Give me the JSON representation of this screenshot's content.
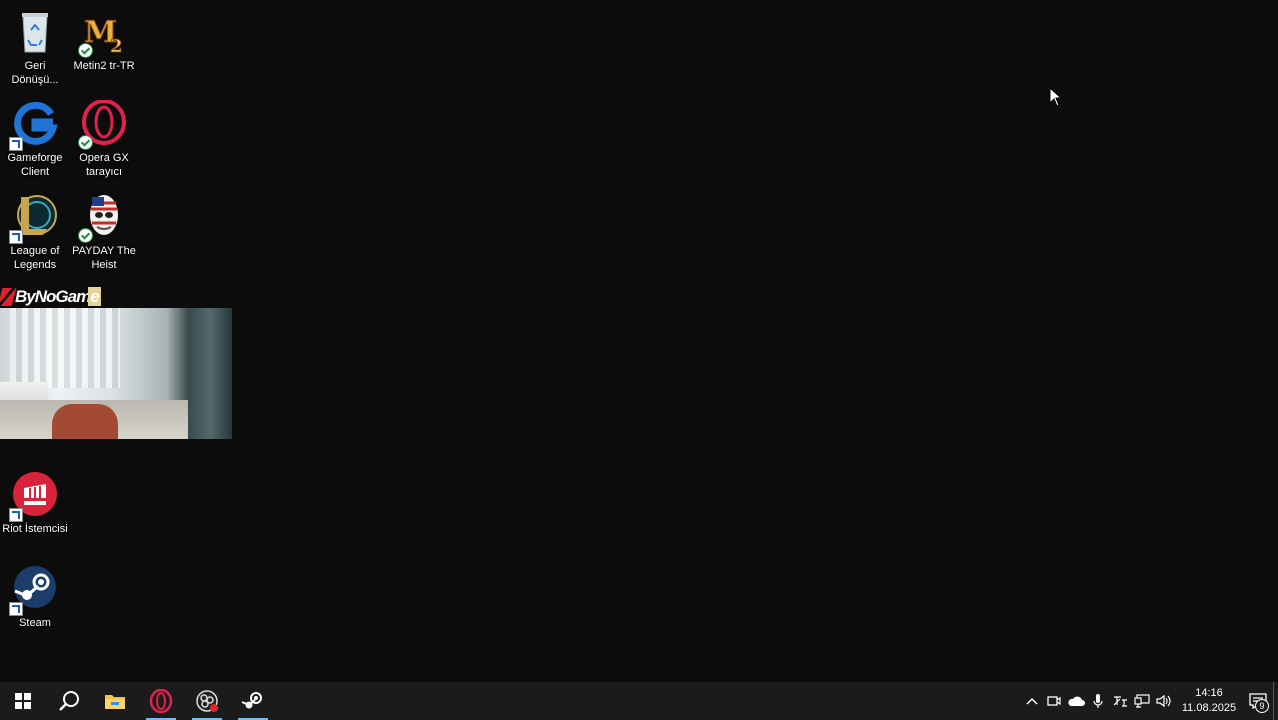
{
  "desktop": {
    "icons": [
      {
        "label": "Geri Dönüşü...",
        "icon": "recycle-bin-icon"
      },
      {
        "label": "Metin2 tr-TR",
        "icon": "metin2-icon"
      },
      {
        "label": "Gameforge Client",
        "icon": "gameforge-icon"
      },
      {
        "label": "Opera GX tarayıcı",
        "icon": "opera-gx-icon"
      },
      {
        "label": "League of Legends",
        "icon": "league-of-legends-icon"
      },
      {
        "label": "PAYDAY The Heist",
        "icon": "payday-icon"
      },
      {
        "label": "Riot İstemcisi",
        "icon": "riot-client-icon"
      },
      {
        "label": "Steam",
        "icon": "steam-icon"
      }
    ],
    "overlay": {
      "brand_main": "ByNoGam",
      "brand_tail": "e"
    }
  },
  "taskbar": {
    "items": [
      "start-icon",
      "search-icon",
      "file-explorer-icon",
      "opera-gx-icon",
      "obs-icon",
      "steam-icon"
    ],
    "clock": {
      "time": "14:16",
      "date": "11.08.2025"
    },
    "notifications": {
      "count": "9"
    },
    "accent": "#76b9ed"
  }
}
